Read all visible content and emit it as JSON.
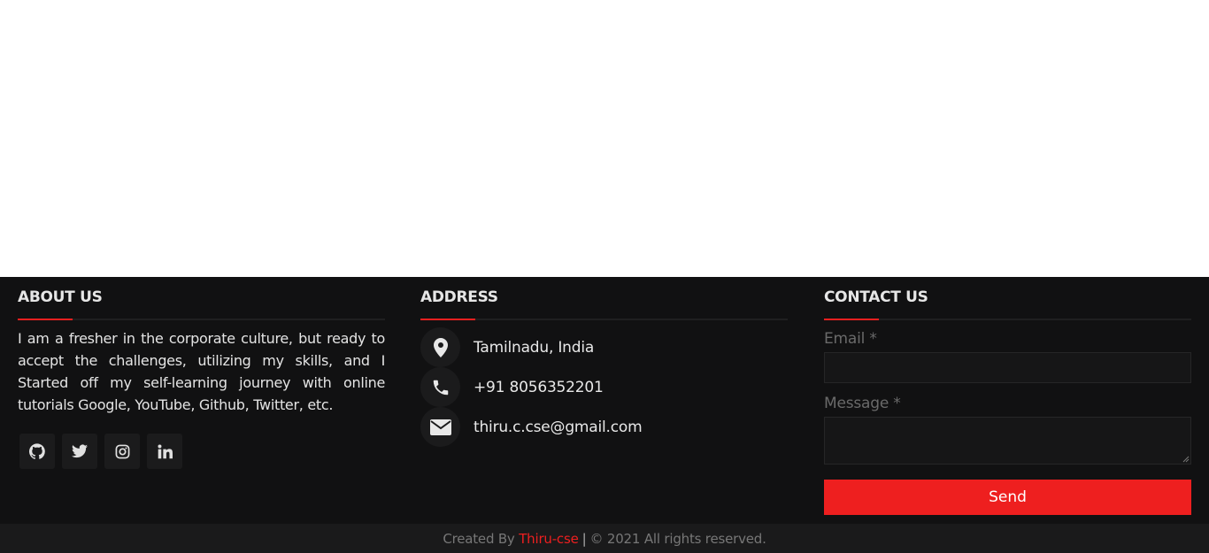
{
  "about": {
    "heading": "ABOUT US",
    "text": "I am a fresher in the corporate culture, but ready to accept the challenges, utilizing my skills, and I Started off my self-learning journey with online tutorials Google, YouTube, Github, Twitter, etc.",
    "socials": [
      {
        "icon": "github-icon"
      },
      {
        "icon": "twitter-icon"
      },
      {
        "icon": "instagram-icon"
      },
      {
        "icon": "linkedin-icon"
      }
    ]
  },
  "address": {
    "heading": "ADDRESS",
    "items": [
      {
        "icon": "location-pin-icon",
        "text": "Tamilnadu, India"
      },
      {
        "icon": "phone-icon",
        "text": "+91 8056352201"
      },
      {
        "icon": "envelope-icon",
        "text": "thiru.c.cse@gmail.com"
      }
    ]
  },
  "contact": {
    "heading": "CONTACT US",
    "email_label": "Email *",
    "message_label": "Message *",
    "send_label": "Send"
  },
  "bottom": {
    "created_by": "Created By",
    "author": "Thiru-cse",
    "separator": "|",
    "copyright_symbol": "©",
    "rights": "2021 All rights reserved."
  },
  "colors": {
    "accent": "#ee1f1f",
    "footer_bg": "#111112",
    "bottom_bg": "#1a1a1b"
  }
}
